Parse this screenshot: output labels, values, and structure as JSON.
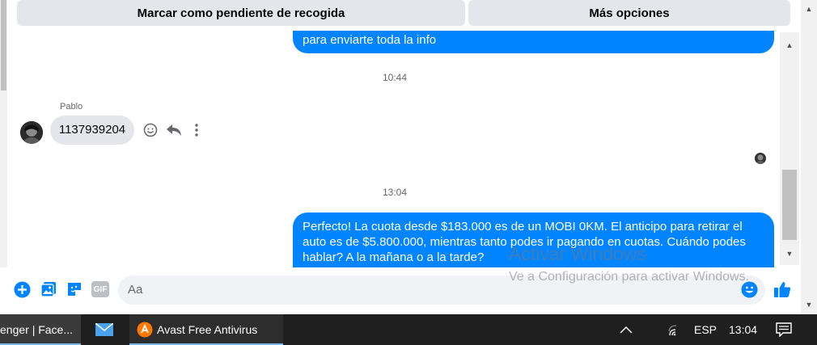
{
  "actions": {
    "mark_pending_label": "Marcar como pendiente de recogida",
    "more_options_label": "Más opciones"
  },
  "conversation": {
    "outgoing_partial": "para enviarte toda la info",
    "time_1": "10:44",
    "sender_name": "Pablo",
    "incoming_message": "1137939204",
    "time_2": "13:04",
    "outgoing_lines": [
      "Perfecto! La cuota desde $183.000 es de un MOBI 0KM. El anticipo para retirar el",
      "auto es de $5.800.000, mientras tanto podes ir pagando en cuotas. Cuándo podes",
      "hablar? A la mañana o a la tarde?"
    ]
  },
  "composer": {
    "placeholder": "Aa",
    "gif_label": "GIF"
  },
  "watermark": {
    "title": "Activar Windows",
    "subtitle": "Ve a Configuración para activar Windows."
  },
  "taskbar": {
    "app_messenger": "enger | Face...",
    "app_avast": "Avast Free Antivirus",
    "language": "ESP",
    "clock": "13:04"
  },
  "colors": {
    "accent": "#0084ff",
    "bubble_incoming": "#e4e6eb",
    "taskbar": "#1f1f1f",
    "avast": "#ff7800"
  },
  "icons": [
    "add-icon",
    "image-icon",
    "sticker-icon",
    "gif-icon",
    "emoji-icon",
    "like-icon",
    "reply-icon",
    "more-icon",
    "mail-icon",
    "avast-icon",
    "chevron-up-icon",
    "wifi-icon",
    "notifications-icon"
  ]
}
